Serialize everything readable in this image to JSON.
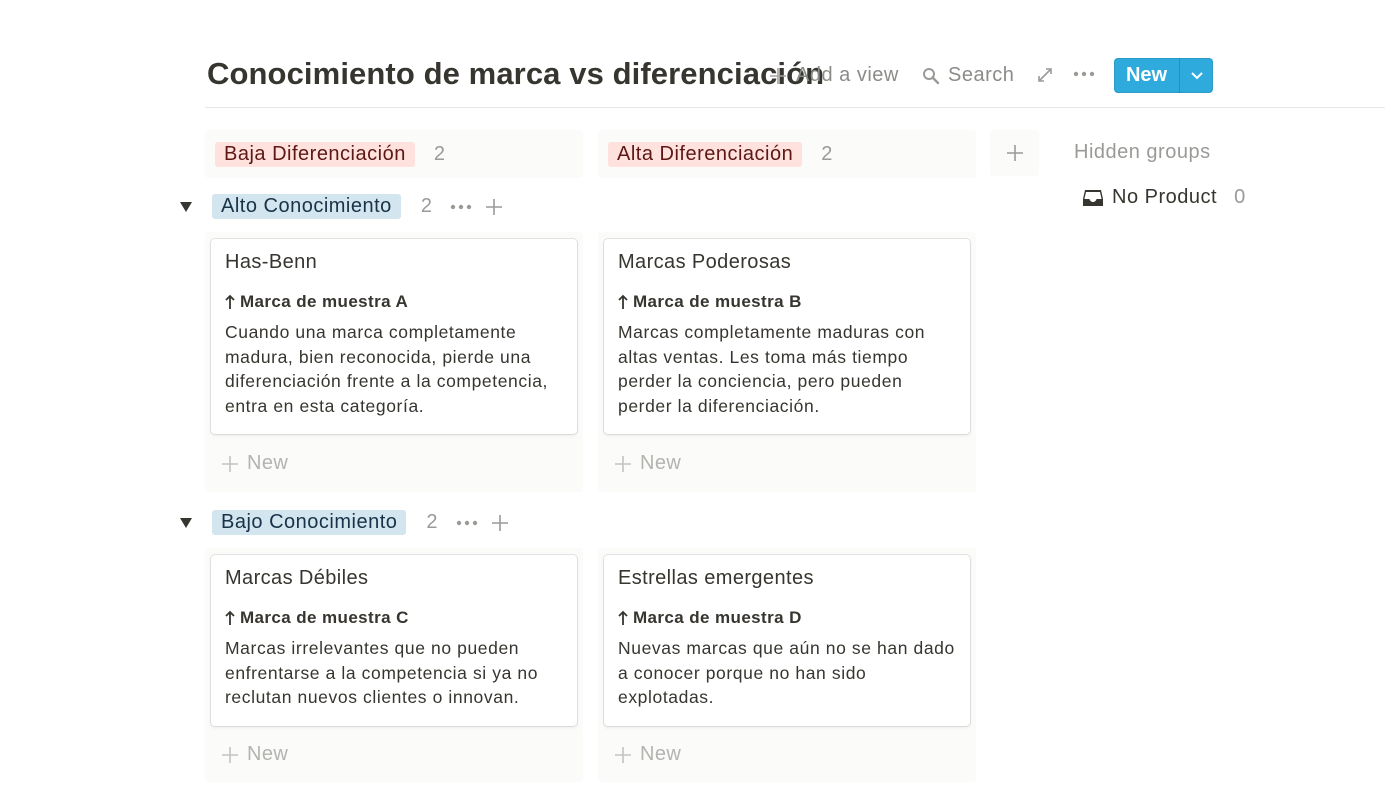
{
  "header": {
    "title": "Conocimiento de marca vs diferenciación",
    "add_view_label": "Add a view",
    "search_label": "Search",
    "new_label": "New"
  },
  "columns": [
    {
      "label": "Baja Diferenciación",
      "count": "2",
      "color": "#ffe2dd"
    },
    {
      "label": "Alta Diferenciación",
      "count": "2",
      "color": "#ffe2dd"
    }
  ],
  "hidden_groups": {
    "title": "Hidden groups",
    "items": [
      {
        "label": "No Product",
        "count": "0",
        "icon": "inbox-icon"
      }
    ]
  },
  "groups": [
    {
      "label": "Alto Conocimiento",
      "count": "2",
      "color": "#d3e5ef",
      "cards": [
        {
          "title": "Has-Benn",
          "prop": "Marca de muestra A",
          "text": "Cuando una marca completamente madura, bien reconocida, pierde una diferenciación frente a la competencia, entra en esta categoría."
        },
        {
          "title": "Marcas Poderosas",
          "prop": "Marca de muestra B",
          "text": "Marcas completamente maduras con altas ventas. Les toma más tiempo perder la conciencia, pero pueden perder la diferenciación."
        }
      ],
      "add_label": "New"
    },
    {
      "label": "Bajo Conocimiento",
      "count": "2",
      "color": "#d3e5ef",
      "cards": [
        {
          "title": "Marcas Débiles",
          "prop": "Marca de muestra C",
          "text": "Marcas irrelevantes que no pueden enfrentarse a la competencia si ya no reclutan nuevos clientes o innovan."
        },
        {
          "title": "Estrellas emergentes",
          "prop": "Marca de muestra D",
          "text": "Nuevas marcas que aún no se han dado a conocer porque no han sido explotadas."
        }
      ],
      "add_label": "New"
    }
  ]
}
